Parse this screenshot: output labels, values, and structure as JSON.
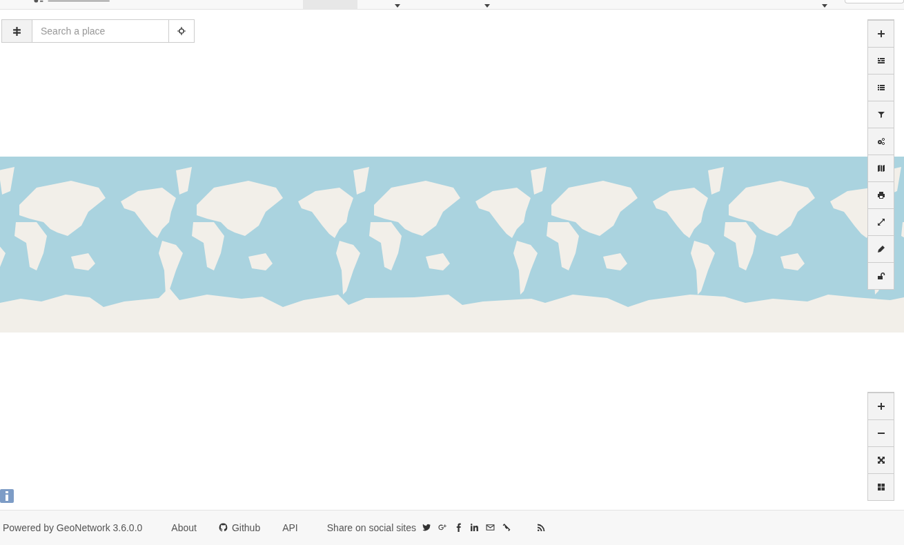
{
  "top_nav": {
    "tabs": [
      {
        "selected": true,
        "dropdown": false
      },
      {
        "selected": false,
        "dropdown": true
      },
      {
        "selected": false,
        "dropdown": true
      }
    ],
    "user_menu": {
      "dropdown": true
    }
  },
  "search": {
    "placeholder": "Search a place"
  },
  "footer": {
    "powered_by": "Powered by GeoNetwork 3.6.0.0",
    "links": [
      {
        "label": "About",
        "kind": "plain"
      },
      {
        "label": "Github",
        "kind": "github"
      },
      {
        "label": "API",
        "kind": "plain"
      }
    ],
    "share_label": "Share on social sites"
  }
}
